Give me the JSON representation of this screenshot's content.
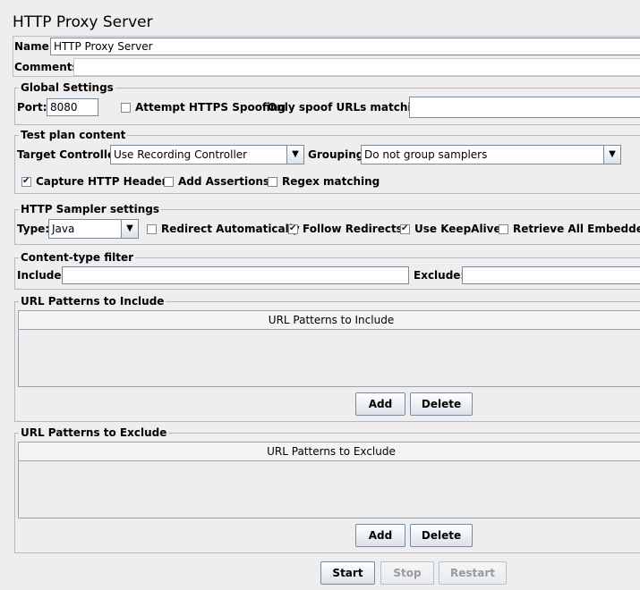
{
  "title": "HTTP Proxy Server",
  "name": {
    "label": "Name:",
    "value": "HTTP Proxy Server"
  },
  "comments": {
    "label": "Comments:",
    "value": ""
  },
  "global_settings": {
    "legend": "Global Settings",
    "port_label": "Port:",
    "port_value": "8080",
    "https_spoofing_label": "Attempt HTTPS Spoofing",
    "https_spoofing_checked": false,
    "spoof_urls_label": "Only spoof URLs matching:",
    "spoof_urls_value": ""
  },
  "test_plan_content": {
    "legend": "Test plan content",
    "target_controller_label": "Target Controller:",
    "target_controller_value": "Use Recording Controller",
    "grouping_label": "Grouping:",
    "grouping_value": "Do not group samplers",
    "capture_headers_label": "Capture HTTP Headers",
    "capture_headers_checked": true,
    "add_assertions_label": "Add Assertions",
    "add_assertions_checked": false,
    "regex_matching_label": "Regex matching",
    "regex_matching_checked": false
  },
  "sampler_settings": {
    "legend": "HTTP Sampler settings",
    "type_label": "Type:",
    "type_value": "Java",
    "redirect_auto_label": "Redirect Automatically",
    "redirect_auto_checked": false,
    "follow_redirects_label": "Follow Redirects",
    "follow_redirects_checked": true,
    "keepalive_label": "Use KeepAlive",
    "keepalive_checked": true,
    "retrieve_embedded_label": "Retrieve All Embedded Re",
    "retrieve_embedded_checked": false
  },
  "content_type_filter": {
    "legend": "Content-type filter",
    "include_label": "Include:",
    "include_value": "",
    "exclude_label": "Exclude:",
    "exclude_value": ""
  },
  "include_patterns": {
    "legend": "URL Patterns to Include",
    "column_header": "URL Patterns to Include",
    "add_label": "Add",
    "delete_label": "Delete"
  },
  "exclude_patterns": {
    "legend": "URL Patterns to Exclude",
    "column_header": "URL Patterns to Exclude",
    "add_label": "Add",
    "delete_label": "Delete"
  },
  "footer": {
    "start_label": "Start",
    "stop_label": "Stop",
    "restart_label": "Restart"
  },
  "icons": {
    "dropdown": "chevron-down-icon",
    "checkbox_mark": "check-icon"
  }
}
